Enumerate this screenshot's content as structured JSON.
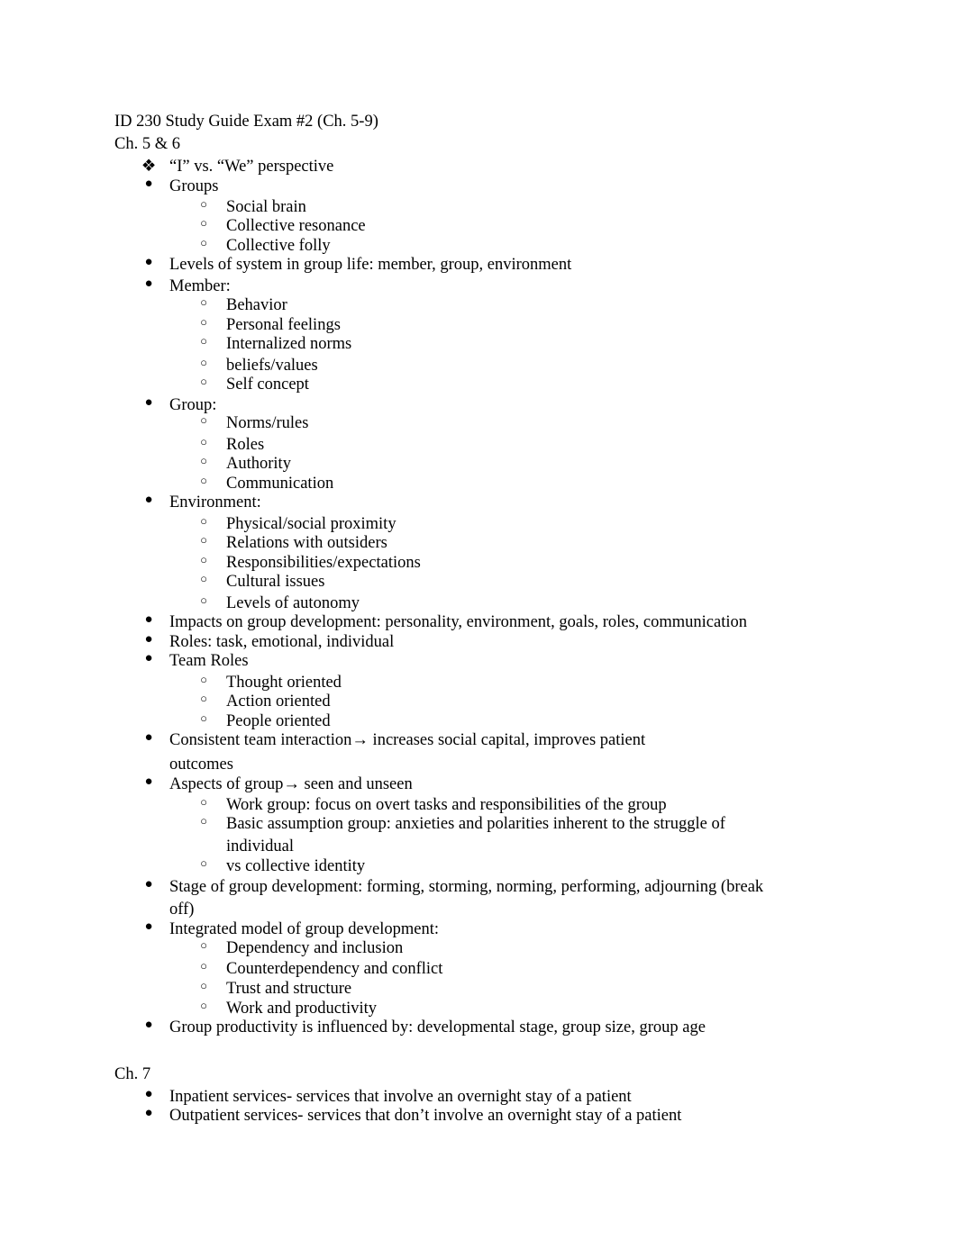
{
  "document": {
    "title": "ID 230 Study Guide Exam #2 (Ch. 5-9)",
    "sections": [
      {
        "heading": "Ch. 5 & 6",
        "items": [
          {
            "text": "“I” vs. “We” perspective",
            "marker": "diamond"
          },
          {
            "text": "Groups",
            "sub": [
              "Social brain",
              "Collective resonance",
              "Collective folly"
            ]
          },
          {
            "text": "Levels of system in group life: member, group, environment"
          },
          {
            "text": "Member:",
            "sub": [
              "Behavior",
              "Personal feelings",
              "Internalized norms",
              "beliefs/values",
              "Self concept"
            ]
          },
          {
            "text": "Group:",
            "sub": [
              "Norms/rules",
              "Roles",
              "Authority",
              "Communication"
            ]
          },
          {
            "text": "Environment:",
            "sub": [
              "Physical/social proximity",
              "Relations with outsiders",
              "Responsibilities/expectations",
              "Cultural issues",
              "Levels of autonomy"
            ]
          },
          {
            "text": "Impacts on group development: personality, environment, goals, roles, communication"
          },
          {
            "text": "Roles: task, emotional, individual"
          },
          {
            "text": "Team Roles",
            "sub": [
              "Thought oriented",
              "Action oriented",
              "People oriented"
            ]
          },
          {
            "text": "Consistent team interaction→ increases social capital, improves patient",
            "cont": "outcomes"
          },
          {
            "text": "Aspects of group→ seen and unseen",
            "sub": [
              "Work group: focus on overt tasks and responsibilities of the group",
              "Basic assumption group: anxieties and polarities inherent to the struggle of",
              "individual",
              "vs collective identity"
            ]
          },
          {
            "text": "Stage of group development: forming, storming, norming, performing, adjourning (break",
            "cont": "off)"
          },
          {
            "text": "Integrated model of group development:",
            "sub": [
              "Dependency and inclusion",
              "Counterdependency and conflict",
              "Trust and structure",
              "Work and productivity"
            ]
          },
          {
            "text": "Group productivity is influenced by: developmental stage, group size, group age"
          }
        ]
      },
      {
        "heading": "Ch. 7",
        "items": [
          {
            "text": "Inpatient services- services that involve an overnight stay of a patient"
          },
          {
            "text": "Outpatient services- services that don’t involve an overnight stay of a patient"
          }
        ]
      }
    ],
    "markers": {
      "diamond": "❖",
      "bullet": "●",
      "circle": "○"
    }
  }
}
